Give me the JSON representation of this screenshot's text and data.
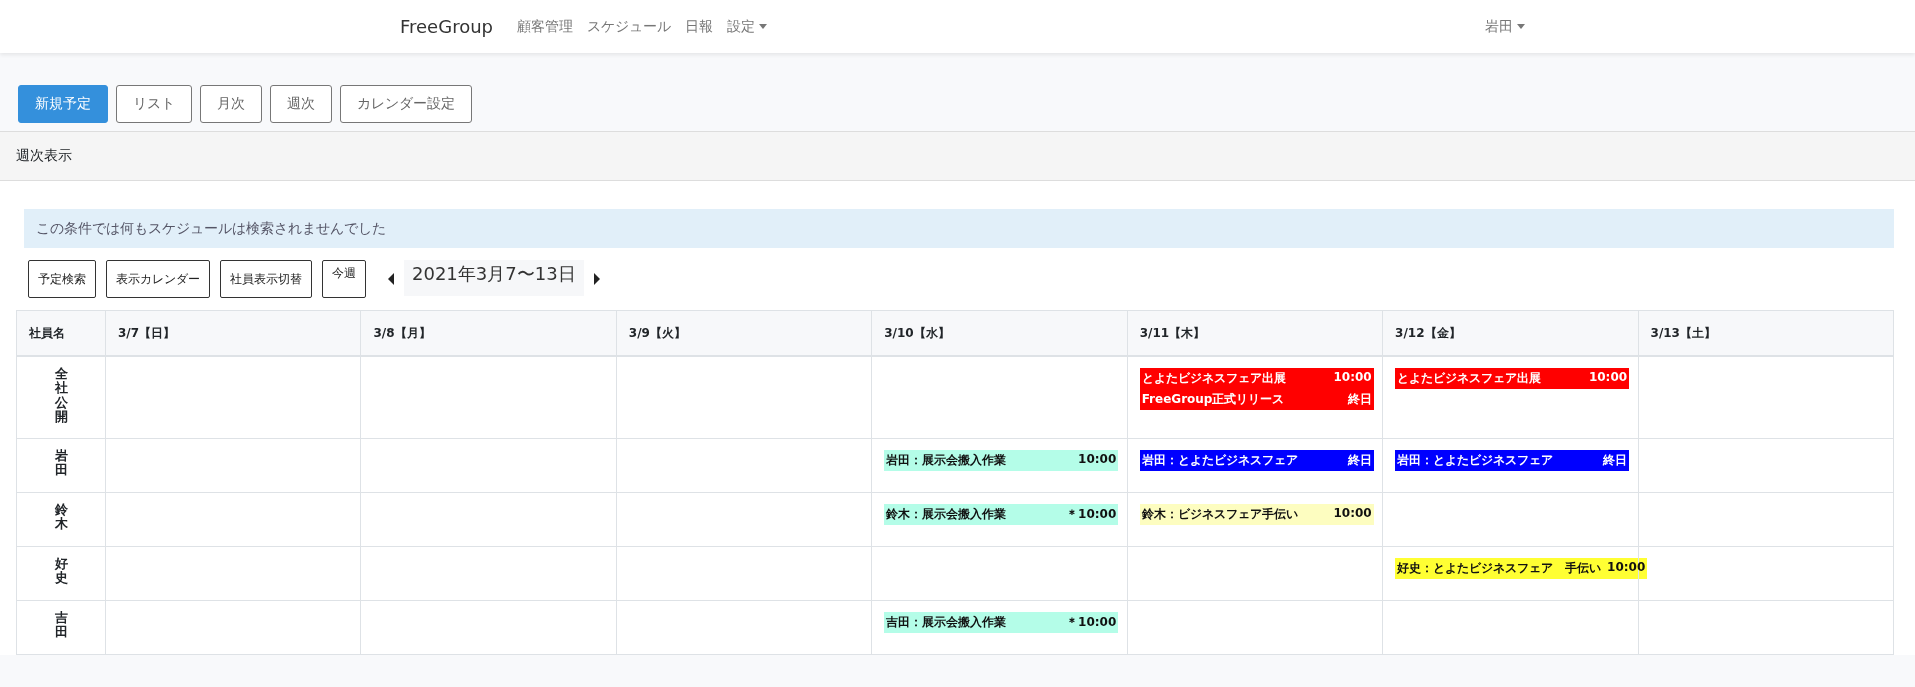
{
  "navbar": {
    "brand": "FreeGroup",
    "links": [
      {
        "label": "顧客管理",
        "dropdown": false
      },
      {
        "label": "スケジュール",
        "dropdown": false
      },
      {
        "label": "日報",
        "dropdown": false
      },
      {
        "label": "設定",
        "dropdown": true
      }
    ],
    "user": {
      "label": "岩田",
      "dropdown": true
    }
  },
  "actions": [
    {
      "label": "新規予定",
      "kind": "primary"
    },
    {
      "label": "リスト",
      "kind": "outline"
    },
    {
      "label": "月次",
      "kind": "outline"
    },
    {
      "label": "週次",
      "kind": "outline"
    },
    {
      "label": "カレンダー設定",
      "kind": "outline"
    }
  ],
  "card": {
    "title": "週次表示",
    "alert": "この条件では何もスケジュールは検索されませんでした",
    "tools": [
      "予定検索",
      "表示カレンダー",
      "社員表示切替",
      "今週"
    ],
    "date_range": "2021年3月7〜13日",
    "table": {
      "name_header": "社員名",
      "columns": [
        "3/7【日】",
        "3/8【月】",
        "3/9【火】",
        "3/10【水】",
        "3/11【木】",
        "3/12【金】",
        "3/13【土】"
      ],
      "rows": [
        {
          "name": "全社公開",
          "cells": [
            [],
            [],
            [],
            [],
            [
              {
                "title": "とよたビジネスフェア出展",
                "time": "10:00",
                "color": "#ff0000"
              },
              {
                "title": "FreeGroup正式リリース",
                "time": "終日",
                "color": "#ff0000"
              }
            ],
            [
              {
                "title": "とよたビジネスフェア出展",
                "time": "10:00",
                "color": "#ff0000"
              }
            ],
            []
          ]
        },
        {
          "name": "岩田",
          "cells": [
            [],
            [],
            [],
            [
              {
                "title": "岩田：展示会搬入作業",
                "time": "10:00",
                "color": "#b4fde8"
              }
            ],
            [
              {
                "title": "岩田：とよたビジネスフェア",
                "time": "終日",
                "color": "#0000ff"
              }
            ],
            [
              {
                "title": "岩田：とよたビジネスフェア",
                "time": "終日",
                "color": "#0000ff"
              }
            ],
            []
          ]
        },
        {
          "name": "鈴木",
          "cells": [
            [],
            [],
            [],
            [
              {
                "title": "鈴木：展示会搬入作業",
                "time": "＊10:00",
                "color": "#b4fde8"
              }
            ],
            [
              {
                "title": "鈴木：ビジネスフェア手伝い",
                "time": "10:00",
                "color": "#fdfdc0"
              }
            ],
            [],
            []
          ]
        },
        {
          "name": "好史",
          "cells": [
            [],
            [],
            [],
            [],
            [],
            [
              {
                "title": "好史：とよたビジネスフェア　手伝い",
                "time": "10:00",
                "color": "#ffff33"
              }
            ],
            []
          ]
        },
        {
          "name": "吉田",
          "cells": [
            [],
            [],
            [],
            [
              {
                "title": "吉田：展示会搬入作業",
                "time": "＊10:00",
                "color": "#b4fde8"
              }
            ],
            [],
            [],
            []
          ]
        }
      ]
    }
  }
}
